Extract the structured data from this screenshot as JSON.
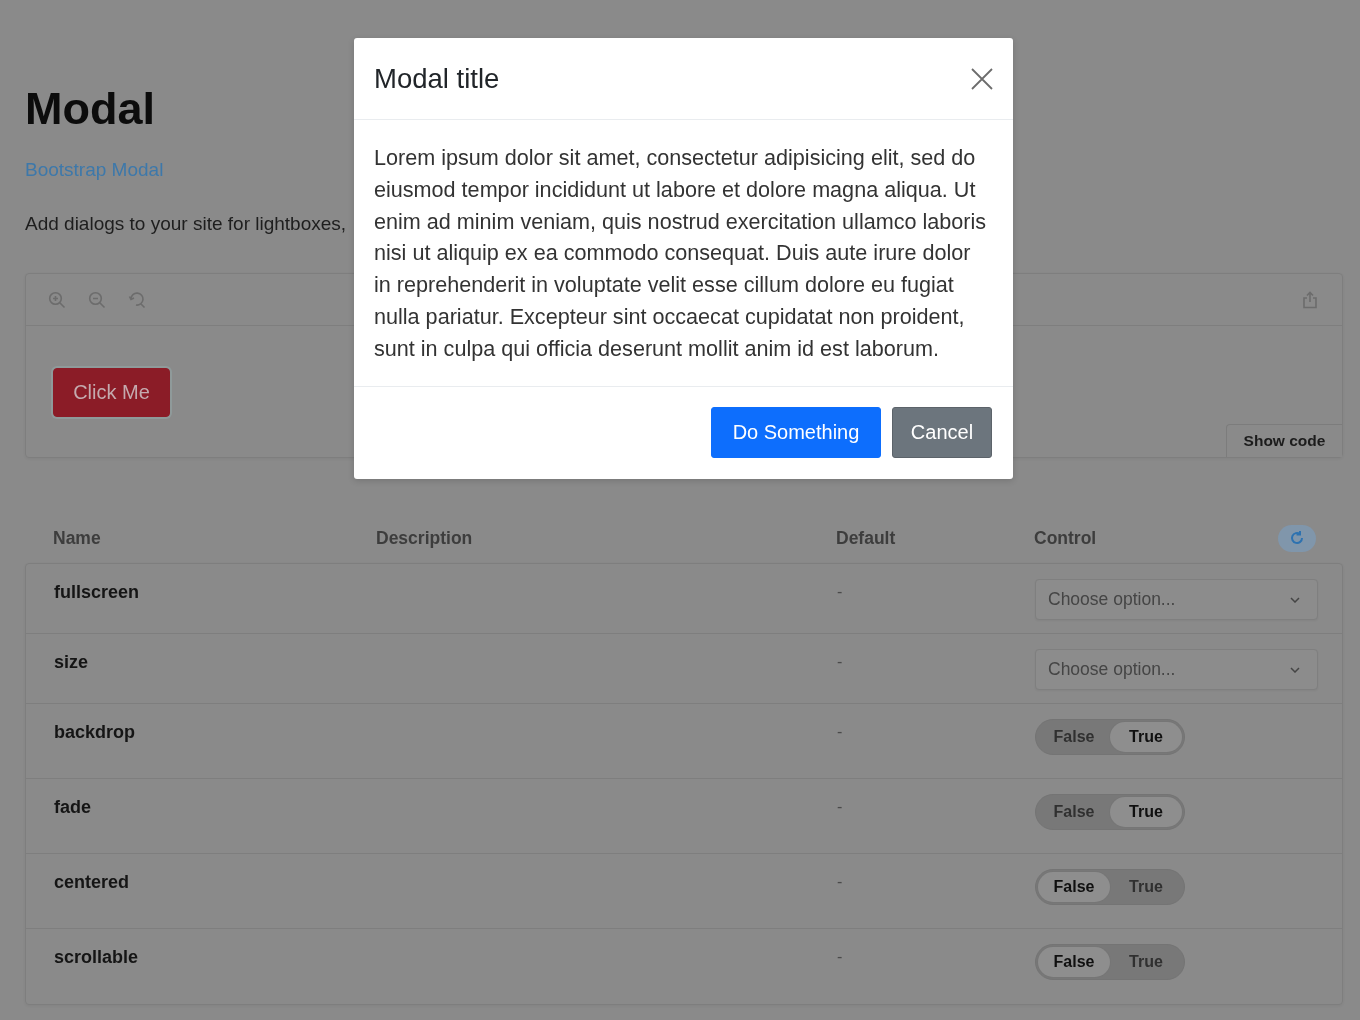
{
  "page": {
    "title": "Modal",
    "link": "Bootstrap Modal",
    "description": "Add dialogs to your site for lightboxes,"
  },
  "preview": {
    "button": "Click Me",
    "show_code": "Show code"
  },
  "props_table": {
    "columns": [
      "Name",
      "Description",
      "Default",
      "Control"
    ],
    "rows": [
      {
        "name": "fullscreen",
        "default": "-",
        "control": {
          "kind": "select",
          "placeholder": "Choose option..."
        }
      },
      {
        "name": "size",
        "default": "-",
        "control": {
          "kind": "select",
          "placeholder": "Choose option..."
        }
      },
      {
        "name": "backdrop",
        "default": "-",
        "control": {
          "kind": "toggle",
          "options": [
            {
              "label": "False",
              "selected": false
            },
            {
              "label": "True",
              "selected": true
            }
          ]
        }
      },
      {
        "name": "fade",
        "default": "-",
        "control": {
          "kind": "toggle",
          "options": [
            {
              "label": "False",
              "selected": false
            },
            {
              "label": "True",
              "selected": true
            }
          ]
        }
      },
      {
        "name": "centered",
        "default": "-",
        "control": {
          "kind": "toggle",
          "options": [
            {
              "label": "False",
              "selected": true
            },
            {
              "label": "True",
              "selected": false
            }
          ]
        }
      },
      {
        "name": "scrollable",
        "default": "-",
        "control": {
          "kind": "toggle",
          "options": [
            {
              "label": "False",
              "selected": true
            },
            {
              "label": "True",
              "selected": false
            }
          ]
        }
      }
    ]
  },
  "modal": {
    "title": "Modal title",
    "body": "Lorem ipsum dolor sit amet, consectetur adipisicing elit, sed do eiusmod tempor incididunt ut labore et dolore magna aliqua. Ut enim ad minim veniam, quis nostrud exercitation ullamco laboris nisi ut aliquip ex ea commodo consequat. Duis aute irure dolor in reprehenderit in voluptate velit esse cillum dolore eu fugiat nulla pariatur. Excepteur sint occaecat cupidatat non proident, sunt in culpa qui officia deserunt mollit anim id est laborum.",
    "buttons": [
      {
        "label": "Do Something",
        "kind": "primary"
      },
      {
        "label": "Cancel",
        "kind": "secondary"
      }
    ]
  }
}
